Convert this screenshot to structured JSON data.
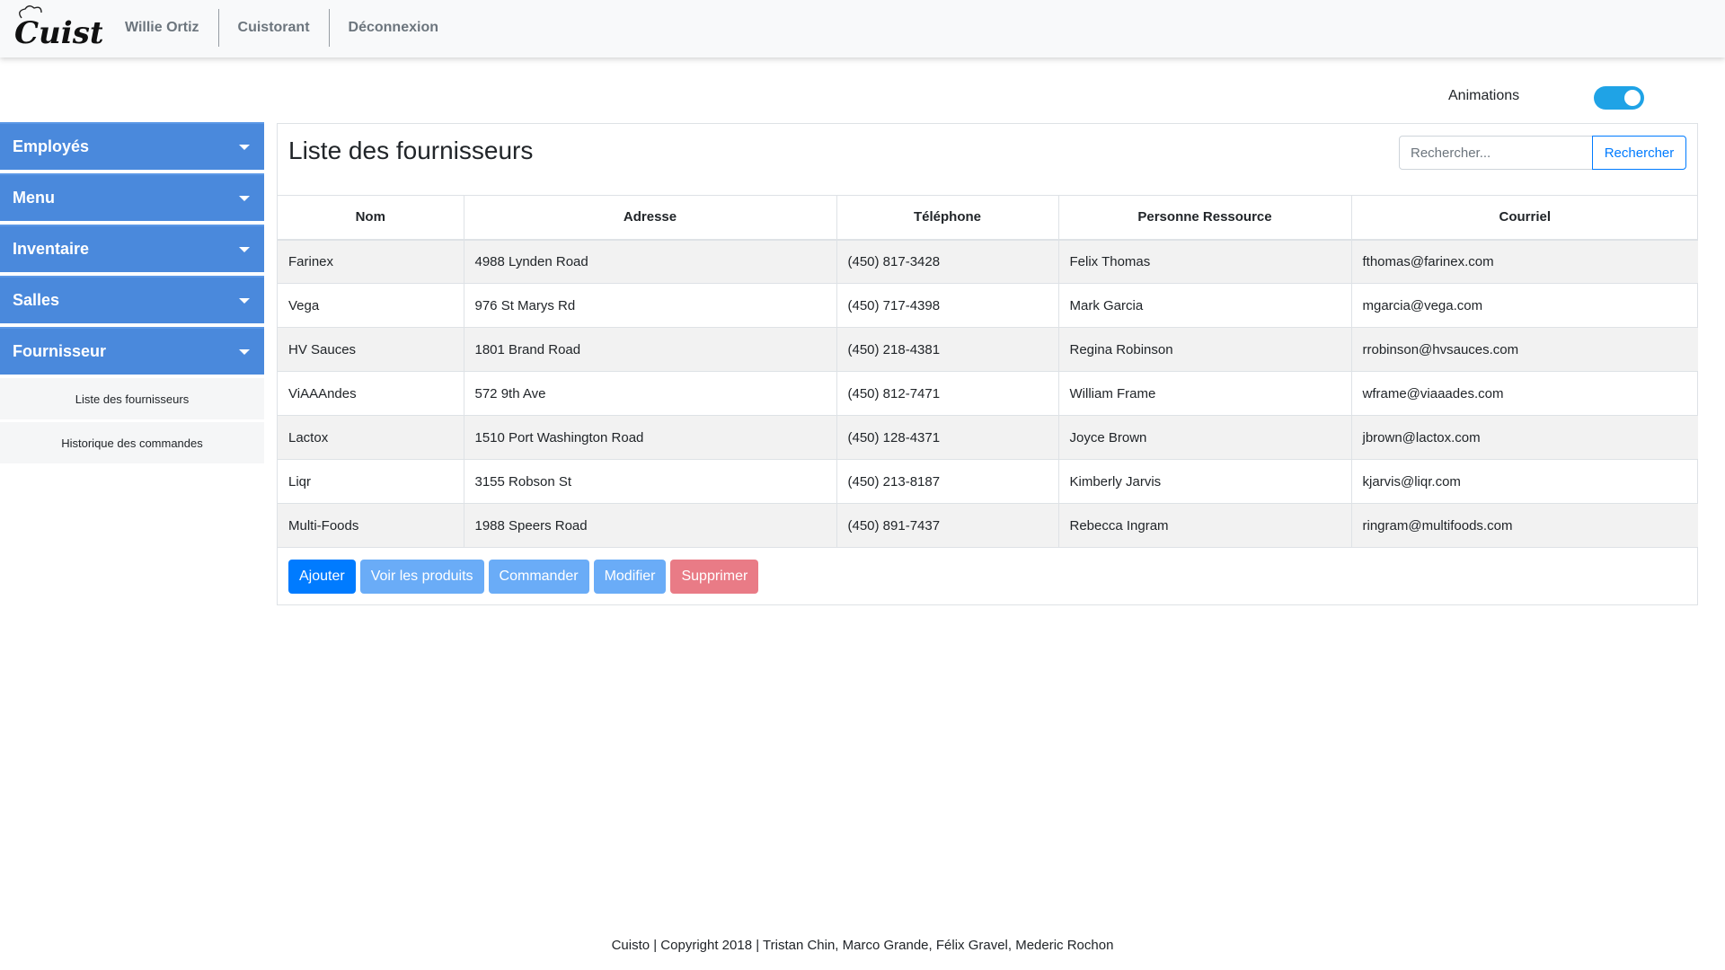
{
  "brand": {
    "logo_text": "Cuisto"
  },
  "nav": {
    "user": "Willie Ortiz",
    "restaurant": "Cuistorant",
    "logout": "Déconnexion"
  },
  "animations": {
    "label": "Animations",
    "enabled": true,
    "accent": "#1fa3e6"
  },
  "sidebar": {
    "items": [
      {
        "label": "Employés"
      },
      {
        "label": "Menu"
      },
      {
        "label": "Inventaire"
      },
      {
        "label": "Salles"
      },
      {
        "label": "Fournisseur"
      }
    ],
    "subitems": [
      {
        "label": "Liste des fournisseurs"
      },
      {
        "label": "Historique des commandes"
      }
    ],
    "color": "#4a89dc"
  },
  "main": {
    "title": "Liste des fournisseurs",
    "search": {
      "placeholder": "Rechercher...",
      "button": "Rechercher"
    },
    "table": {
      "headers": [
        "Nom",
        "Adresse",
        "Téléphone",
        "Personne Ressource",
        "Courriel"
      ],
      "rows": [
        [
          "Farinex",
          "4988 Lynden Road",
          "(450) 817-3428",
          "Felix Thomas",
          "fthomas@farinex.com"
        ],
        [
          "Vega",
          "976 St Marys Rd",
          "(450) 717-4398",
          "Mark Garcia",
          "mgarcia@vega.com"
        ],
        [
          "HV Sauces",
          "1801 Brand Road",
          "(450) 218-4381",
          "Regina Robinson",
          "rrobinson@hvsauces.com"
        ],
        [
          "ViAAAndes",
          "572 9th Ave",
          "(450) 812-7471",
          "William Frame",
          "wframe@viaaades.com"
        ],
        [
          "Lactox",
          "1510 Port Washington Road",
          "(450) 128-4371",
          "Joyce Brown",
          "jbrown@lactox.com"
        ],
        [
          "Liqr",
          "3155 Robson St",
          "(450) 213-8187",
          "Kimberly Jarvis",
          "kjarvis@liqr.com"
        ],
        [
          "Multi-Foods",
          "1988 Speers Road",
          "(450) 891-7437",
          "Rebecca Ingram",
          "ringram@multifoods.com"
        ]
      ]
    },
    "actions": {
      "add": "Ajouter",
      "view_products": "Voir les produits",
      "order": "Commander",
      "edit": "Modifier",
      "delete": "Supprimer"
    }
  },
  "footer": {
    "text": "Cuisto | Copyright 2018 | Tristan Chin, Marco Grande, Félix Gravel, Mederic Rochon"
  }
}
